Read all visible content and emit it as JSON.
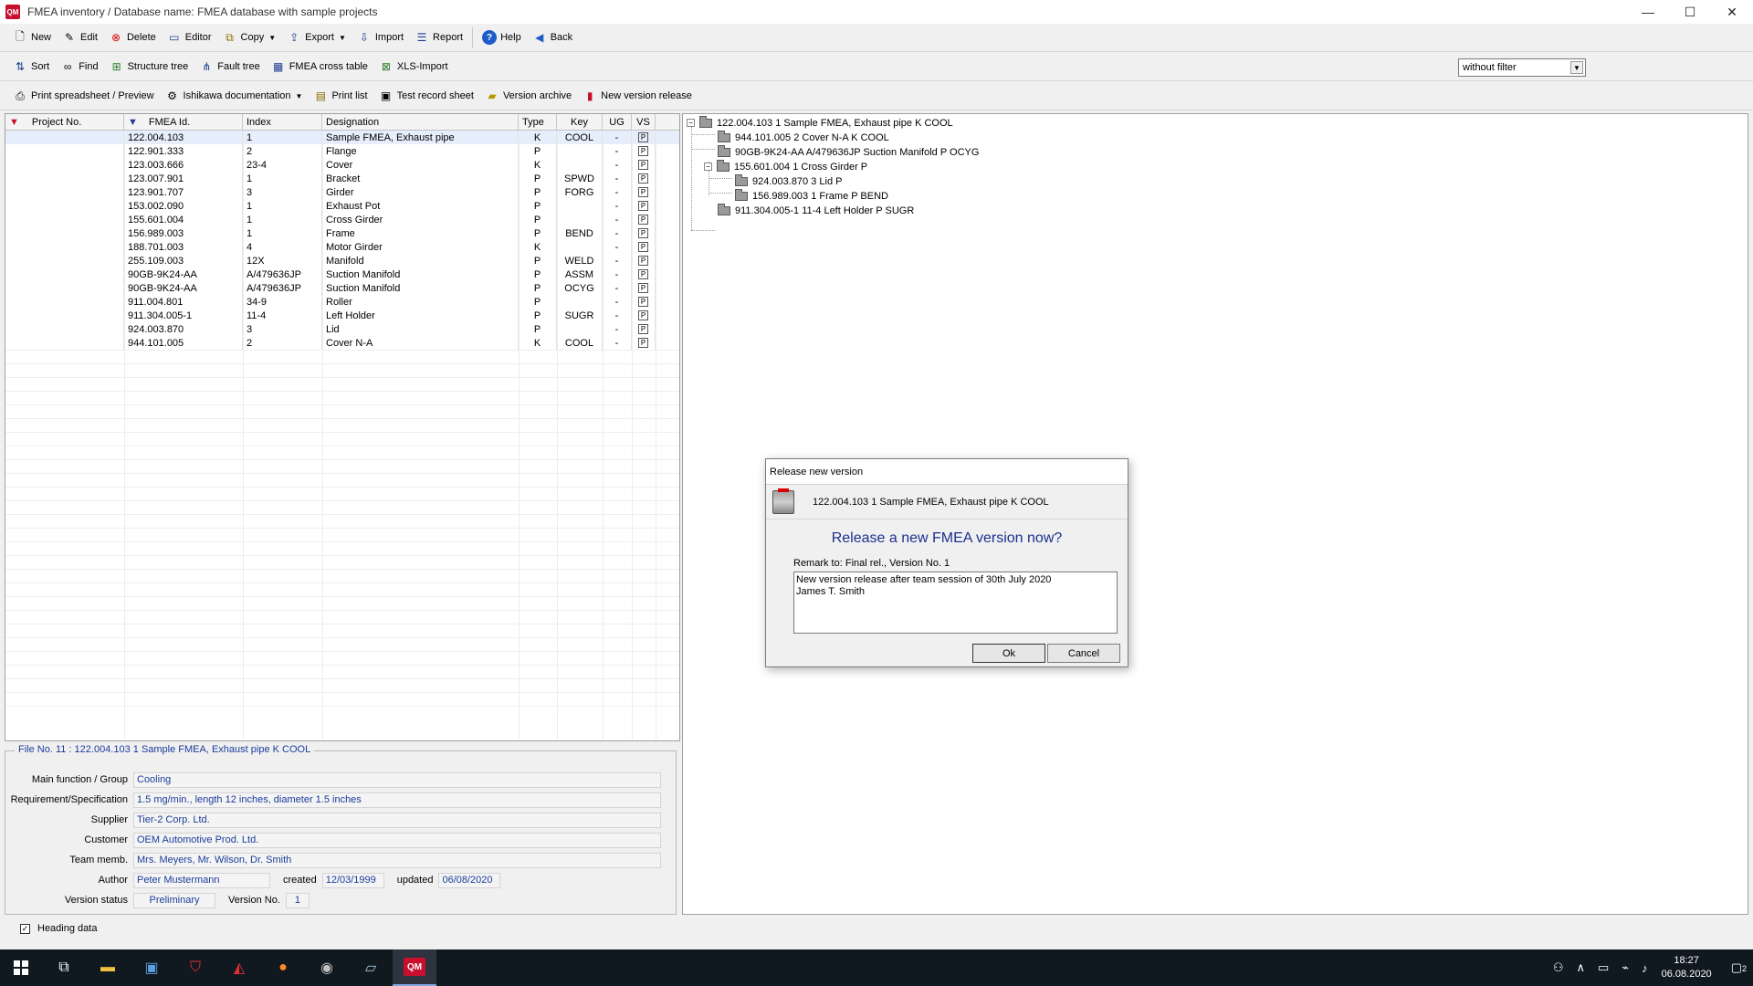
{
  "window": {
    "logo": "QM",
    "title": "FMEA inventory / Database name: FMEA database with sample projects",
    "controls": [
      "—",
      "☐",
      "✕"
    ]
  },
  "toolbar1": [
    {
      "label": "New",
      "icon": "new-doc-icon"
    },
    {
      "label": "Edit",
      "icon": "edit-icon"
    },
    {
      "label": "Delete",
      "icon": "delete-icon"
    },
    {
      "label": "Editor",
      "icon": "editor-icon"
    },
    {
      "label": "Copy",
      "icon": "copy-icon"
    },
    {
      "label": "Export",
      "icon": "export-icon"
    },
    {
      "label": "Import",
      "icon": "import-icon"
    },
    {
      "label": "Report",
      "icon": "report-icon"
    },
    {
      "label": "Help",
      "icon": "help-icon"
    },
    {
      "label": "Back",
      "icon": "back-arrow-icon"
    }
  ],
  "toolbar2": [
    {
      "label": "Sort",
      "icon": "sort-icon"
    },
    {
      "label": "Find",
      "icon": "binoculars-icon"
    },
    {
      "label": "Structure tree",
      "icon": "structure-tree-icon"
    },
    {
      "label": "Fault tree",
      "icon": "fault-tree-icon"
    },
    {
      "label": "FMEA cross table",
      "icon": "cross-table-icon"
    },
    {
      "label": "XLS-Import",
      "icon": "xls-icon"
    }
  ],
  "filter": {
    "value": "without filter"
  },
  "toolbar3": [
    {
      "label": "Print spreadsheet / Preview",
      "icon": "printer-icon"
    },
    {
      "label": "Ishikawa documentation",
      "icon": "ishikawa-icon"
    },
    {
      "label": "Print list",
      "icon": "print-list-icon"
    },
    {
      "label": "Test record sheet",
      "icon": "test-record-icon"
    },
    {
      "label": "Version archive",
      "icon": "archive-icon"
    },
    {
      "label": "New version release",
      "icon": "version-release-icon"
    }
  ],
  "grid": {
    "columns": [
      "Project No.",
      "FMEA Id.",
      "Index",
      "Designation",
      "Type",
      "Key",
      "UG",
      "VS"
    ],
    "rows": [
      {
        "fmea": "122.004.103",
        "index": "1",
        "designation": "Sample FMEA, Exhaust pipe",
        "type": "K",
        "key": "COOL",
        "ug": "-",
        "vs": "P"
      },
      {
        "fmea": "122.901.333",
        "index": "2",
        "designation": "Flange",
        "type": "P",
        "key": "",
        "ug": "-",
        "vs": "P"
      },
      {
        "fmea": "123.003.666",
        "index": "23-4",
        "designation": "Cover",
        "type": "K",
        "key": "",
        "ug": "-",
        "vs": "P"
      },
      {
        "fmea": "123.007.901",
        "index": "1",
        "designation": "Bracket",
        "type": "P",
        "key": "SPWD",
        "ug": "-",
        "vs": "P"
      },
      {
        "fmea": "123.901.707",
        "index": "3",
        "designation": "Girder",
        "type": "P",
        "key": "FORG",
        "ug": "-",
        "vs": "P"
      },
      {
        "fmea": "153.002.090",
        "index": "1",
        "designation": "Exhaust Pot",
        "type": "P",
        "key": "",
        "ug": "-",
        "vs": "P"
      },
      {
        "fmea": "155.601.004",
        "index": "1",
        "designation": "Cross Girder",
        "type": "P",
        "key": "",
        "ug": "-",
        "vs": "P"
      },
      {
        "fmea": "156.989.003",
        "index": "1",
        "designation": "Frame",
        "type": "P",
        "key": "BEND",
        "ug": "-",
        "vs": "P"
      },
      {
        "fmea": "188.701.003",
        "index": "4",
        "designation": "Motor Girder",
        "type": "K",
        "key": "",
        "ug": "-",
        "vs": "P"
      },
      {
        "fmea": "255.109.003",
        "index": "12X",
        "designation": "Manifold",
        "type": "P",
        "key": "WELD",
        "ug": "-",
        "vs": "P"
      },
      {
        "fmea": "90GB-9K24-AA",
        "index": "A/479636JP",
        "designation": "Suction Manifold",
        "type": "P",
        "key": "ASSM",
        "ug": "-",
        "vs": "P"
      },
      {
        "fmea": "90GB-9K24-AA",
        "index": "A/479636JP",
        "designation": "Suction Manifold",
        "type": "P",
        "key": "OCYG",
        "ug": "-",
        "vs": "P"
      },
      {
        "fmea": "911.004.801",
        "index": "34-9",
        "designation": "Roller",
        "type": "P",
        "key": "",
        "ug": "-",
        "vs": "P"
      },
      {
        "fmea": "911.304.005-1",
        "index": "11-4",
        "designation": "Left Holder",
        "type": "P",
        "key": "SUGR",
        "ug": "-",
        "vs": "P"
      },
      {
        "fmea": "924.003.870",
        "index": "3",
        "designation": "Lid",
        "type": "P",
        "key": "",
        "ug": "-",
        "vs": "P"
      },
      {
        "fmea": "944.101.005",
        "index": "2",
        "designation": "Cover N-A",
        "type": "K",
        "key": "COOL",
        "ug": "-",
        "vs": "P"
      }
    ]
  },
  "tree": {
    "nodes": [
      {
        "label": "122.004.103  1  Sample FMEA, Exhaust pipe  K  COOL",
        "toggle": "−"
      },
      {
        "label": "944.101.005  2  Cover N-A  K  COOL",
        "toggle": ""
      },
      {
        "label": "90GB-9K24-AA  A/479636JP  Suction Manifold  P  OCYG",
        "toggle": ""
      },
      {
        "label": "155.601.004  1  Cross Girder  P",
        "toggle": "−"
      },
      {
        "label": "924.003.870  3  Lid  P",
        "toggle": ""
      },
      {
        "label": "156.989.003  1  Frame  P  BEND",
        "toggle": ""
      },
      {
        "label": "911.304.005-1  11-4  Left Holder  P  SUGR",
        "toggle": ""
      }
    ]
  },
  "heading": {
    "title": "File No.  11 :   122.004.103  1  Sample FMEA, Exhaust pipe  K  COOL",
    "main_function_label": "Main function / Group",
    "main_function": "Cooling",
    "requirement_label": "Requirement/Specification",
    "requirement": "1.5 mg/min., length 12 inches, diameter 1.5 inches",
    "supplier_label": "Supplier",
    "supplier": "Tier-2 Corp. Ltd.",
    "customer_label": "Customer",
    "customer": "OEM Automotive Prod. Ltd.",
    "team_label": "Team memb.",
    "team": "Mrs. Meyers, Mr. Wilson, Dr. Smith",
    "author_label": "Author",
    "author": "Peter Mustermann",
    "created_label": "created",
    "created": "12/03/1999",
    "updated_label": "updated",
    "updated": "06/08/2020",
    "version_status_label": "Version status",
    "version_status": "Preliminary",
    "version_no_label": "Version No.",
    "version_no": "1"
  },
  "heading_checkbox": {
    "label": "Heading data",
    "checked": "✓"
  },
  "dialog": {
    "title": "Release new version",
    "header": "122.004.103  1  Sample FMEA, Exhaust pipe  K  COOL",
    "question": "Release a new FMEA version now?",
    "remark_label": "Remark to: Final rel., Version No. 1",
    "remark_text": "New version release after team session of 30th July 2020\nJames T. Smith",
    "ok": "Ok",
    "cancel": "Cancel"
  },
  "taskbar": {
    "app_badge": "QM",
    "time": "18:27",
    "date": "06.08.2020",
    "notification_count": "2"
  }
}
